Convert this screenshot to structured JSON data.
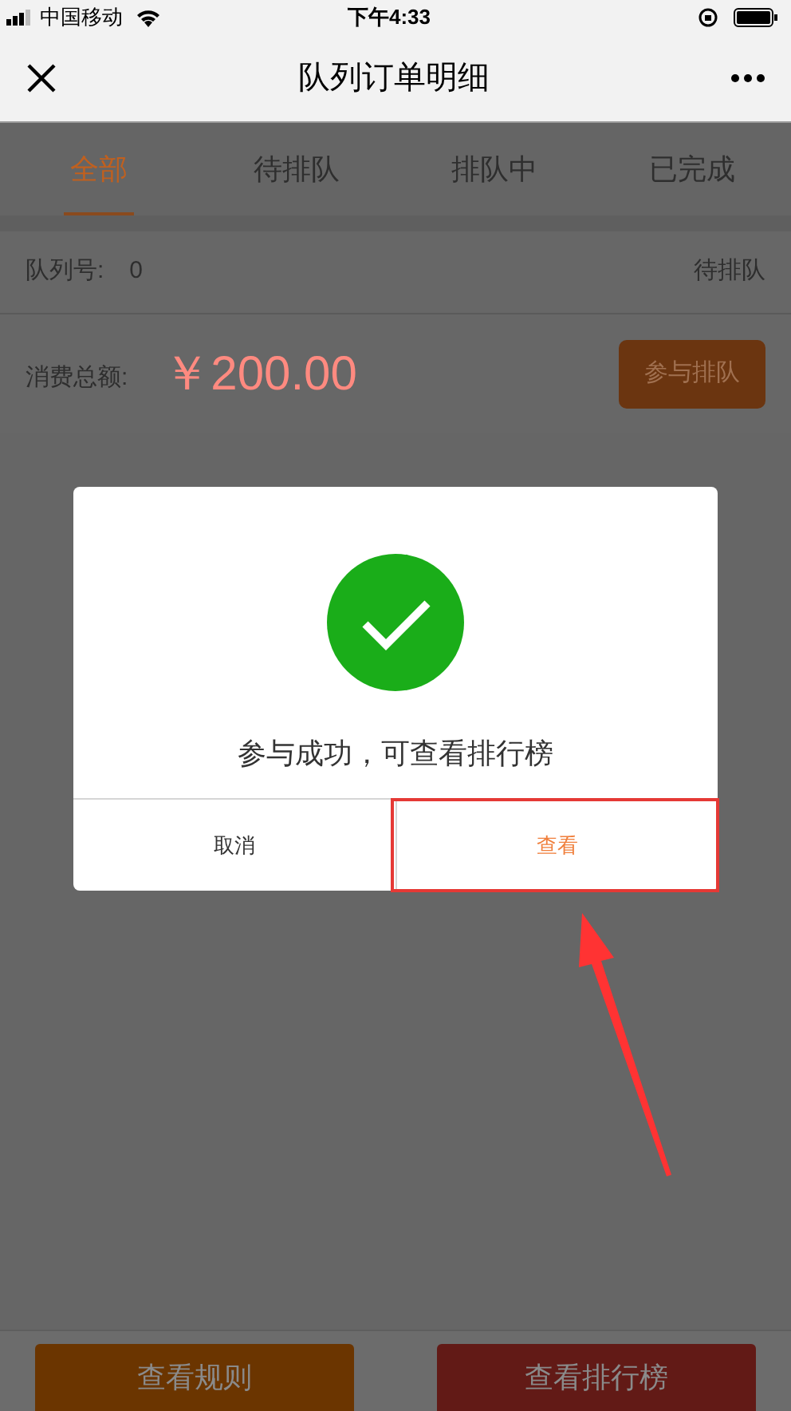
{
  "status_bar": {
    "carrier": "中国移动",
    "time": "下午4:33"
  },
  "nav": {
    "title": "队列订单明细"
  },
  "tabs": [
    {
      "label": "全部",
      "selected": true
    },
    {
      "label": "待排队",
      "selected": false
    },
    {
      "label": "排队中",
      "selected": false
    },
    {
      "label": "已完成",
      "selected": false
    }
  ],
  "order": {
    "queue_label": "队列号:",
    "queue_number": "0",
    "status": "待排队",
    "total_label": "消费总额:",
    "total": "￥200.00",
    "join_button": "参与排队"
  },
  "dialog": {
    "message": "参与成功，可查看排行榜",
    "buttons": [
      {
        "label": "取消",
        "kind": "cancel"
      },
      {
        "label": "查看",
        "kind": "confirm"
      }
    ]
  },
  "bottom_buttons": [
    {
      "label": "查看规则",
      "kind": "rules"
    },
    {
      "label": "查看排行榜",
      "kind": "ranking"
    }
  ]
}
